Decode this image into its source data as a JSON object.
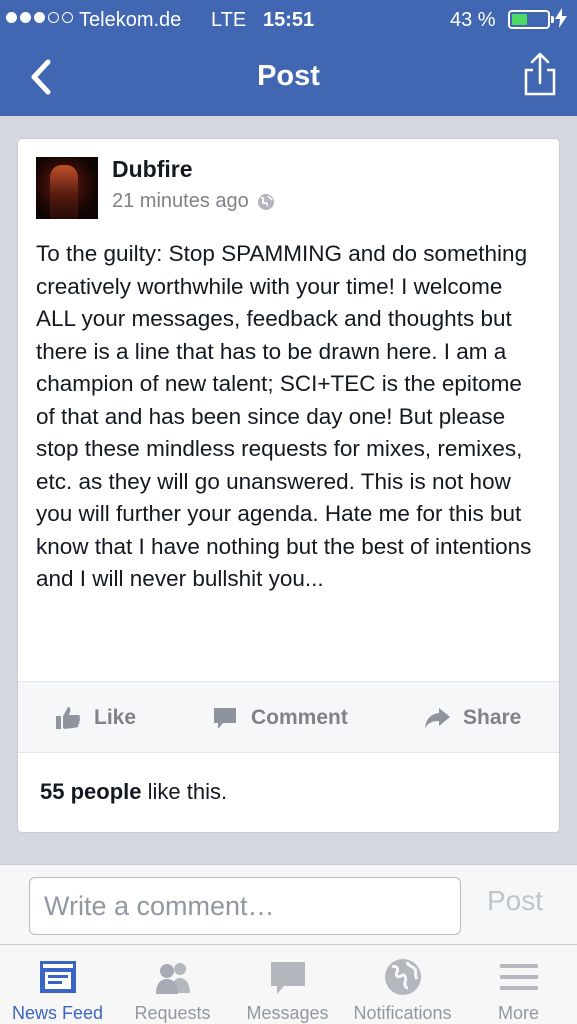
{
  "status": {
    "carrier": "Telekom.de",
    "network": "LTE",
    "time": "15:51",
    "battery_percent_label": "43 %",
    "battery_level": 0.43,
    "signal_bars_filled": 3,
    "signal_bars_total": 5
  },
  "nav": {
    "title": "Post",
    "back_icon": "chevron-left-icon",
    "share_icon": "share-upload-icon"
  },
  "post": {
    "author": "Dubfire",
    "time_ago": "21 minutes ago",
    "privacy_icon": "globe-icon",
    "text": "To the guilty: Stop SPAMMING and do something creatively worthwhile with your time! I welcome ALL your messages, feedback and thoughts but there is a line that has to be drawn here. I am a champion of new talent; SCI+TEC is the epitome of that and has been since day one! But please stop these mindless requests for mixes, remixes, etc. as they will go unanswered. This is not how you will further your agenda. Hate me for this but know that I have nothing but the best of intentions and I will never bullshit you...",
    "actions": {
      "like": "Like",
      "comment": "Comment",
      "share": "Share"
    },
    "likes_count": "55 people",
    "likes_suffix": " like this."
  },
  "comment": {
    "placeholder": "Write a comment…",
    "post_label": "Post"
  },
  "tabs": [
    {
      "label": "News Feed",
      "icon": "news-feed-icon",
      "active": true
    },
    {
      "label": "Requests",
      "icon": "requests-icon",
      "active": false
    },
    {
      "label": "Messages",
      "icon": "messages-icon",
      "active": false
    },
    {
      "label": "Notifications",
      "icon": "notifications-icon",
      "active": false
    },
    {
      "label": "More",
      "icon": "more-icon",
      "active": false
    }
  ],
  "colors": {
    "brand_blue": "#4166b2",
    "active_tab": "#3b65c4",
    "battery_green": "#4cd964",
    "muted_text": "#7f8289"
  }
}
